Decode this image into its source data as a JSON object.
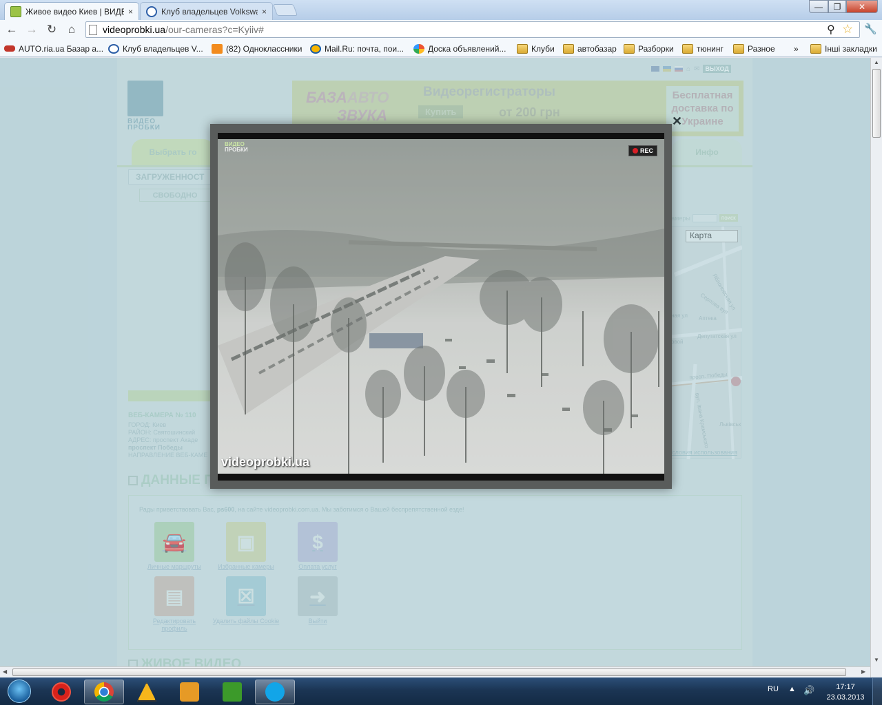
{
  "browser": {
    "tabs": [
      {
        "label": "Живое видео Киев | ВИДЕ",
        "active": true,
        "close": "×"
      },
      {
        "label": "Клуб владельцев Volkswa",
        "active": false,
        "close": "×"
      }
    ],
    "window_controls": {
      "minimize": "—",
      "maximize": "❐",
      "close": "✕"
    },
    "url_host": "videoprobki.ua",
    "url_path": "/our-cameras?c=Kyiiv#",
    "bookmarks": [
      {
        "label": "AUTO.ria.ua Базар а...",
        "icon": "car-icon"
      },
      {
        "label": "Клуб владельцев V...",
        "icon": "vw-logo-icon"
      },
      {
        "label": "(82) Одноклассники",
        "icon": "odnoklassniki-icon"
      },
      {
        "label": "Mail.Ru: почта, пои...",
        "icon": "mailru-icon"
      },
      {
        "label": "Доска объявлений...",
        "icon": "slando-icon"
      },
      {
        "label": "Клуби",
        "icon": "folder-icon"
      },
      {
        "label": "автобазар",
        "icon": "folder-icon"
      },
      {
        "label": "Разборки",
        "icon": "folder-icon"
      },
      {
        "label": "тюнинг",
        "icon": "folder-icon"
      },
      {
        "label": "Разное",
        "icon": "folder-icon"
      }
    ],
    "bookmarks_more": "»",
    "other_bookmarks": "Інші закладки"
  },
  "site": {
    "logo_text_1": "ВИДЕО",
    "logo_text_2": "ПРОБКИ",
    "exit_label": "ВЫХОД",
    "banner": {
      "name_1": "БАЗА",
      "name_2": "АВТО",
      "name_3": "ЗВУКА",
      "slogan": "Видеорегистраторы",
      "buy": "Купить",
      "price": "от 200 грн",
      "delivery": "Бесплатная доставка по Украине",
      "close": "✕"
    },
    "nav_tabs": {
      "choose": "Выбрать го",
      "info": "Инфо"
    },
    "load_label": "ЗАГРУЖЕННОСТ",
    "free_label": "СВОБОДНО",
    "map": {
      "search_label": "мамеры",
      "search_button": "поиск",
      "type_select": "Карта",
      "streets": [
        "Яблоновская ул",
        "Серпова вул",
        "Аптека",
        "Депутатская ул",
        "ная ул",
        "овой",
        "просп. Победы",
        "вул. Івана Крамського",
        "Львівськ"
      ],
      "terms": "Условия использования"
    },
    "camera": {
      "title": "ВЕБ-КАМЕРА № 110",
      "city": "ГОРОД: Киев",
      "district": "РАЙОН: Святошинский",
      "address": "АДРЕС: проспект Акаде",
      "address2": "проспект Победы",
      "direction": "НАПРАВЛЕНИЕ ВЕБ-КАМЕ"
    },
    "data_section": {
      "title": "ДАННЫЕ П",
      "welcome_prefix": "Рады приветствовать Вас, ",
      "username": "ps600",
      "welcome_suffix": ", на сайте videoprobki.com.ua. Мы заботимся о Вашей беспрепятственной езде!",
      "items": [
        {
          "label": "Личные маршруты",
          "icon": "car-route-icon",
          "glyph": "🚘"
        },
        {
          "label": "Избранные камеры",
          "icon": "camera-monitor-icon",
          "glyph": "▣"
        },
        {
          "label": "Оплата услуг",
          "icon": "dollar-icon",
          "glyph": "$"
        },
        {
          "label": "Редактировать профиль",
          "icon": "profile-card-icon",
          "glyph": "▤"
        },
        {
          "label": "Удалить файлы Cookie",
          "icon": "delete-x-icon",
          "glyph": "☒"
        },
        {
          "label": "Выйти",
          "icon": "exit-arrow-icon",
          "glyph": "➜"
        }
      ]
    },
    "live_section_title": "ЖИВОЕ ВИДЕО"
  },
  "popup": {
    "logo_1": "ВИДЕО",
    "logo_2": "ПРОБКИ",
    "rec_label": "REC",
    "watermark": "videoprobki.ua"
  },
  "taskbar": {
    "apps": [
      "opera-icon",
      "chrome-icon",
      "aimp-icon",
      "media-player-icon",
      "utorrent-icon",
      "skype-icon"
    ],
    "lang": "RU",
    "time": "17:17",
    "date": "23.03.2013"
  }
}
